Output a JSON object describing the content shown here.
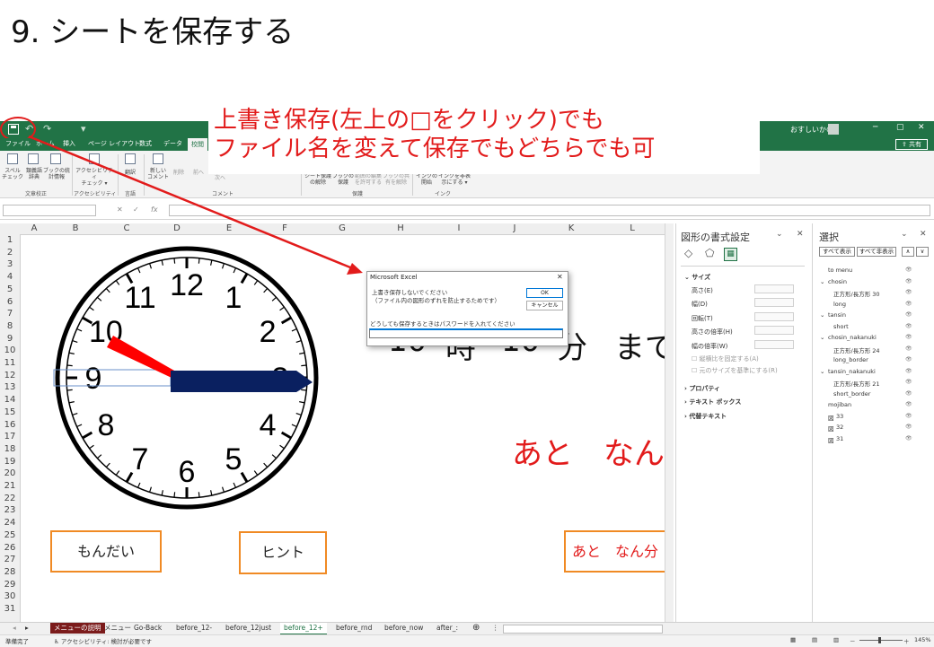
{
  "slide": {
    "title": "9. シートを保存する",
    "annotation_line1": "上書き保存(左上の□をクリック)でも",
    "annotation_line2": "ファイル名を変えて保存でもどちらでも可",
    "accent_color": "#e21b1b"
  },
  "titlebar": {
    "qat_undo": "↶",
    "qat_redo": "↷",
    "qat_more": "▾",
    "user": "おすしいかの",
    "minimize": "─",
    "restore": "▢",
    "close": "✕",
    "color": "#217346"
  },
  "ribbon_tabs": [
    "ファイル",
    "ホーム",
    "挿入",
    "ページ レイアウト",
    "数式",
    "データ",
    "校閲"
  ],
  "share_label": "共有",
  "ribbon": {
    "spelling": "スペル\nチェック",
    "thesaurus": "類義語\n辞典",
    "workbook_stats": "ブックの統\n計情報",
    "group_proofing": "文章校正",
    "accessibility": "アクセシビリティ\nチェック ▾",
    "group_accessibility": "アクセシビリティ",
    "translate": "翻訳",
    "group_language": "言語",
    "new_comment": "新しい\nコメント",
    "delete": "削除",
    "prev": "前へ",
    "next": "次へ",
    "group_comments": "コメント",
    "unprotect_sheet": "シート保護\nの解除",
    "protect_workbook": "ブックの\n保護",
    "allow_edit_ranges": "範囲の編集\nを許可する",
    "unshare": "ブックの共\n有を解除",
    "group_protect": "保護",
    "start_inking": "インクの\n開始",
    "hide_ink": "インクを非表\n示にする ▾",
    "group_ink": "インク"
  },
  "formula_bar": {
    "cancel": "✕",
    "enter": "✓",
    "fx": "fx"
  },
  "columns": [
    "A",
    "B",
    "C",
    "D",
    "E",
    "F",
    "G",
    "H",
    "I",
    "J",
    "K",
    "L"
  ],
  "rows": [
    "1",
    "2",
    "3",
    "4",
    "5",
    "6",
    "7",
    "8",
    "9",
    "10",
    "11",
    "12",
    "13",
    "14",
    "15",
    "16",
    "17",
    "18",
    "19",
    "20",
    "21",
    "22",
    "23",
    "24",
    "25",
    "26",
    "27",
    "28",
    "29",
    "30",
    "31"
  ],
  "clock": {
    "numbers": [
      "12",
      "1",
      "2",
      "3",
      "4",
      "5",
      "6",
      "7",
      "8",
      "9",
      "10",
      "11"
    ],
    "hour_hand_color": "#ff0000",
    "minute_hand_color": "#0a2060"
  },
  "sheet_text": {
    "time_hour": "10",
    "time_ji": "時",
    "time_min": "10",
    "time_fun": "分",
    "time_made": "まで",
    "ato_nan": "あと　なん",
    "button_mondai": "もんだい",
    "button_hint": "ヒント",
    "button_ato_nanpun": "あと　なん分"
  },
  "dialog": {
    "title": "Microsoft Excel",
    "close": "✕",
    "message": "上書き保存しないでください\n（ファイル内の図形のずれを防止するためです）",
    "prompt": "どうしても保存するときはパスワードを入れてください",
    "ok": "OK",
    "cancel": "キャンセル"
  },
  "format_pane": {
    "title": "図形の書式設定",
    "section_size": "サイズ",
    "height": "高さ(E)",
    "width": "幅(D)",
    "rotation": "回転(T)",
    "scale_height": "高さの倍率(H)",
    "scale_width": "幅の倍率(W)",
    "lock_aspect": "縦横比を固定する(A)",
    "relative_original": "元のサイズを基準にする(R)",
    "properties": "プロパティ",
    "textbox": "テキスト ボックス",
    "alt_text": "代替テキスト",
    "collapse": "⌄",
    "close": "✕"
  },
  "selection_pane": {
    "title": "選択",
    "show_all": "すべて表示",
    "hide_all": "すべて非表示",
    "up": "∧",
    "down": "∨",
    "collapse": "⌄",
    "close": "✕",
    "items": [
      {
        "label": "to menu"
      },
      {
        "label": "chosin",
        "expand": "⌄"
      },
      {
        "label": "正方形/長方形 30"
      },
      {
        "label": "long"
      },
      {
        "label": "tansin",
        "expand": "⌄"
      },
      {
        "label": "short"
      },
      {
        "label": "chosin_nakanuki",
        "expand": "⌄"
      },
      {
        "label": "正方形/長方形 24"
      },
      {
        "label": "long_border"
      },
      {
        "label": "tansin_nakanuki",
        "expand": "⌄"
      },
      {
        "label": "正方形/長方形 21"
      },
      {
        "label": "short_border"
      },
      {
        "label": "mojiban"
      },
      {
        "label": "33",
        "icon": "図"
      },
      {
        "label": "32",
        "icon": "図"
      },
      {
        "label": "31",
        "icon": "図"
      }
    ]
  },
  "sheet_tabs": [
    "メニューの説明",
    "メニュー",
    "Go-Back",
    "before_12-",
    "before_12just",
    "before_12+",
    "before_rnd",
    "before_now",
    "after_:"
  ],
  "sheet_nav": {
    "prev": "◂",
    "next": "▸",
    "add": "⊕",
    "more": "⋮"
  },
  "status": {
    "ready": "準備完了",
    "accessibility": "アクセシビリティ: 検討が必要です",
    "zoom": "145%",
    "minus": "－",
    "plus": "＋"
  }
}
